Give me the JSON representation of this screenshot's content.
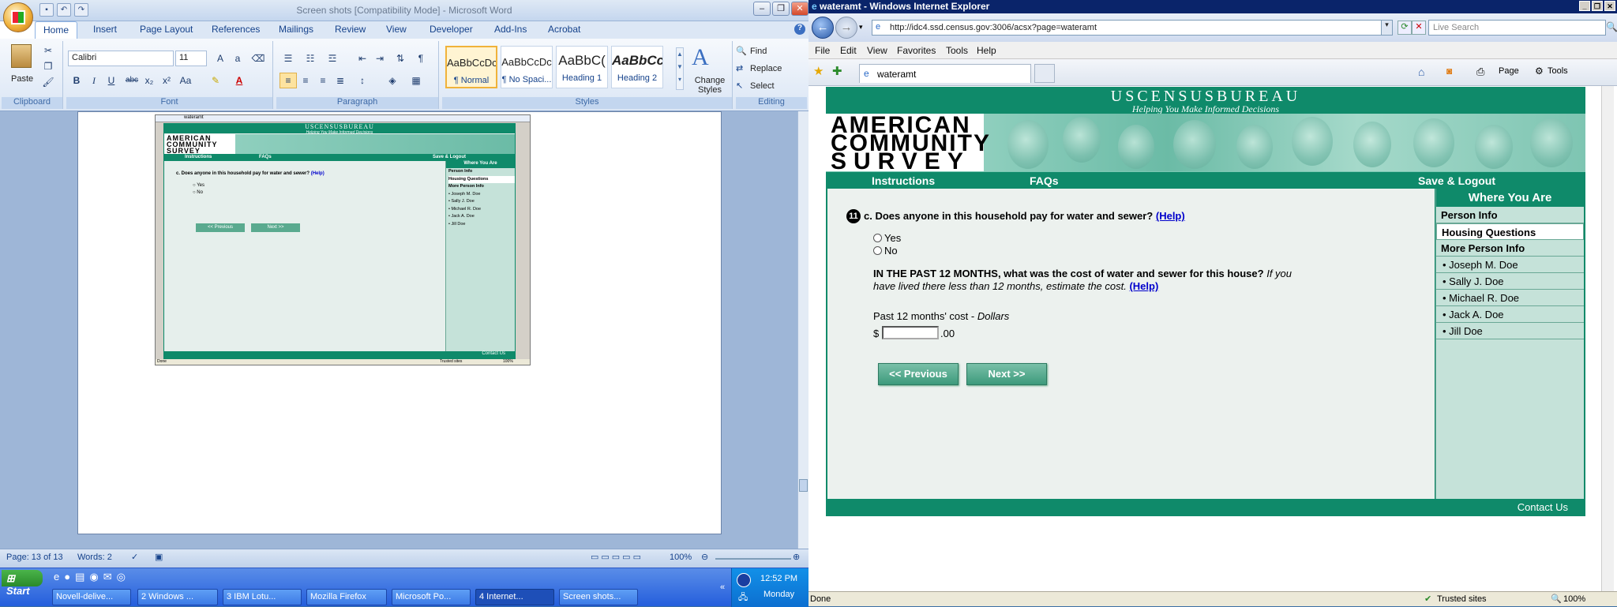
{
  "word": {
    "title": "Screen shots [Compatibility Mode] - Microsoft Word",
    "tabs": [
      "Home",
      "Insert",
      "Page Layout",
      "References",
      "Mailings",
      "Review",
      "View",
      "Developer",
      "Add-Ins",
      "Acrobat"
    ],
    "font_name": "Calibri",
    "font_size": "11",
    "groups": {
      "clipboard": "Clipboard",
      "font": "Font",
      "paragraph": "Paragraph",
      "styles": "Styles",
      "editing": "Editing"
    },
    "paste_label": "Paste",
    "styles": [
      {
        "preview": "AaBbCcDc",
        "name": "¶ Normal"
      },
      {
        "preview": "AaBbCcDc",
        "name": "¶ No Spaci..."
      },
      {
        "preview": "AaBbC(",
        "name": "Heading 1"
      },
      {
        "preview": "AaBbCc",
        "name": "Heading 2"
      }
    ],
    "change_styles": "Change Styles",
    "editing": {
      "find": "Find",
      "replace": "Replace",
      "select": "Select"
    },
    "status": {
      "page": "Page: 13 of 13",
      "words": "Words: 2",
      "zoom": "100%"
    }
  },
  "thumbnail": {
    "tab": "wateramt",
    "bureau": "USCENSUSBUREAU",
    "tagline": "Helping You Make Informed Decisions",
    "logo": [
      "AMERICAN",
      "COMMUNITY",
      "SURVEY"
    ],
    "nav": [
      "Instructions",
      "FAQs",
      "Save & Logout"
    ],
    "question": "c. Does anyone in this household pay for water and sewer?",
    "help": "(Help)",
    "opts": [
      "Yes",
      "No"
    ],
    "prev": "<<  Previous",
    "next": "Next  >>",
    "side_head": "Where You Are",
    "side": [
      "Person Info",
      "Housing Questions",
      "More Person Info",
      "• Joseph M. Doe",
      "• Sally J. Doe",
      "• Michael R. Doe",
      "• Jack A. Doe",
      "• Jill Doe"
    ],
    "footer": "Contact Us",
    "status": "Done",
    "trusted": "Trusted sites",
    "zoom": "100%"
  },
  "ie": {
    "title": "wateramt - Windows Internet Explorer",
    "url": "http://idc4.ssd.census.gov:3006/acsx?page=wateramt",
    "search_placeholder": "Live Search",
    "menu": [
      "File",
      "Edit",
      "View",
      "Favorites",
      "Tools",
      "Help"
    ],
    "tab": "wateramt",
    "toolbar": {
      "page": "Page",
      "tools": "Tools"
    },
    "status": "Done",
    "trusted": "Trusted sites",
    "zoom": "100%"
  },
  "census": {
    "bureau": "USCENSUSBUREAU",
    "tagline": "Helping You Make Informed Decisions",
    "logo": [
      "AMERICAN",
      "COMMUNITY",
      "SURVEY"
    ],
    "nav": {
      "instructions": "Instructions",
      "faqs": "FAQs",
      "logout": "Save & Logout"
    },
    "question_number": "11",
    "question": "c. Does anyone in this household pay for water and sewer?",
    "help": "(Help)",
    "options": [
      "Yes",
      "No"
    ],
    "cost_question_bold": "IN THE PAST 12 MONTHS, what was the cost of water and sewer for this house?",
    "cost_question_italic": "If you have lived there less than 12 months, estimate the cost.",
    "cost_help": "(Help)",
    "cost_label": "Past 12 months' cost -",
    "cost_unit": "Dollars",
    "currency": "$",
    "cents": ".00",
    "cost_value": "",
    "prev_button": "<<   Previous",
    "next_button": "Next   >>",
    "side_heading": "Where You Are",
    "side_items": [
      "Person Info",
      "Housing Questions",
      "More Person Info",
      "• Joseph M. Doe",
      "• Sally J. Doe",
      "• Michael R. Doe",
      "• Jack A. Doe",
      "• Jill Doe"
    ],
    "footer": "Contact Us"
  },
  "taskbar": {
    "start": "Start",
    "tasks": [
      "Novell-delive...",
      "2 Windows ...",
      "3 IBM Lotu...",
      "Mozilla Firefox",
      "Microsoft Po...",
      "4 Internet...",
      "Screen shots..."
    ],
    "time": "12:52 PM",
    "day": "Monday"
  }
}
